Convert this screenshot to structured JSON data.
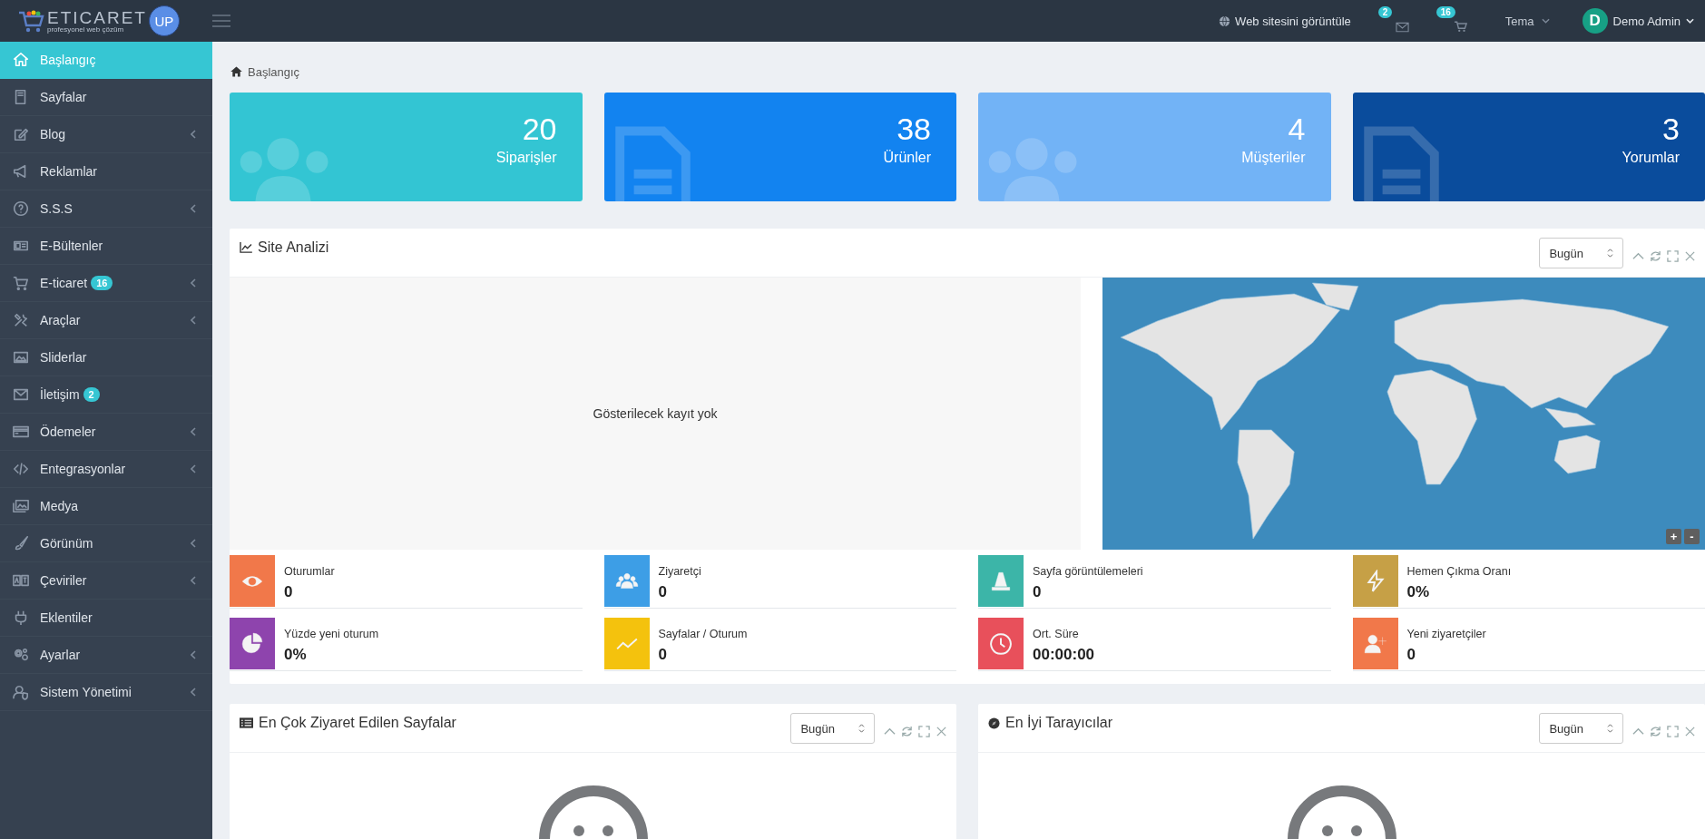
{
  "logo": {
    "name": "ETICARET",
    "badge": "UP",
    "tagline": "profesyonel web çözüm"
  },
  "topbar": {
    "site_link": "Web sitesini görüntüle",
    "messages_badge": "2",
    "orders_badge": "16",
    "theme": "Tema",
    "avatar_letter": "D",
    "user": "Demo Admin"
  },
  "sidebar": {
    "items": [
      {
        "label": "Başlangıç",
        "selected": true,
        "submenu": false
      },
      {
        "label": "Sayfalar",
        "selected": false,
        "submenu": false
      },
      {
        "label": "Blog",
        "selected": false,
        "submenu": true
      },
      {
        "label": "Reklamlar",
        "selected": false,
        "submenu": false
      },
      {
        "label": "S.S.S",
        "selected": false,
        "submenu": true
      },
      {
        "label": "E-Bültenler",
        "selected": false,
        "submenu": false
      },
      {
        "label": "E-ticaret",
        "selected": false,
        "submenu": true,
        "badge": "16"
      },
      {
        "label": "Araçlar",
        "selected": false,
        "submenu": true
      },
      {
        "label": "Sliderlar",
        "selected": false,
        "submenu": false
      },
      {
        "label": "İletişim",
        "selected": false,
        "submenu": false,
        "badge": "2"
      },
      {
        "label": "Ödemeler",
        "selected": false,
        "submenu": true
      },
      {
        "label": "Entegrasyonlar",
        "selected": false,
        "submenu": true
      },
      {
        "label": "Medya",
        "selected": false,
        "submenu": false
      },
      {
        "label": "Görünüm",
        "selected": false,
        "submenu": true
      },
      {
        "label": "Çeviriler",
        "selected": false,
        "submenu": true
      },
      {
        "label": "Eklentiler",
        "selected": false,
        "submenu": false
      },
      {
        "label": "Ayarlar",
        "selected": false,
        "submenu": true
      },
      {
        "label": "Sistem Yönetimi",
        "selected": false,
        "submenu": true
      }
    ]
  },
  "breadcrumb": "Başlangıç",
  "stats": [
    {
      "value": "20",
      "label": "Siparişler",
      "color": "#33c5d3",
      "kind": "people"
    },
    {
      "value": "38",
      "label": "Ürünler",
      "color": "#1283f0",
      "kind": "document"
    },
    {
      "value": "4",
      "label": "Müşteriler",
      "color": "#72b3f6",
      "kind": "people"
    },
    {
      "value": "3",
      "label": "Yorumlar",
      "color": "#0a4c9c",
      "kind": "document"
    }
  ],
  "site_analysis": {
    "title": "Site Analizi",
    "period": "Bugün",
    "empty_message": "Gösterilecek kayıt yok",
    "map_zoom_in": "+",
    "map_zoom_out": "-",
    "metrics": [
      {
        "label": "Oturumlar",
        "value": "0",
        "color": "#f1784a",
        "kind": "eye"
      },
      {
        "label": "Ziyaretçi",
        "value": "0",
        "color": "#3d9ee6",
        "kind": "users"
      },
      {
        "label": "Sayfa görüntülemeleri",
        "value": "0",
        "color": "#3cb5a8",
        "kind": "cone"
      },
      {
        "label": "Hemen Çıkma Oranı",
        "value": "0%",
        "color": "#c6a046",
        "kind": "bolt"
      },
      {
        "label": "Yüzde yeni oturum",
        "value": "0%",
        "color": "#8e44ad",
        "kind": "pie"
      },
      {
        "label": "Sayfalar / Oturum",
        "value": "0",
        "color": "#f4c20d",
        "kind": "line"
      },
      {
        "label": "Ort. Süre",
        "value": "00:00:00",
        "color": "#e8505b",
        "kind": "clock"
      },
      {
        "label": "Yeni ziyaretçiler",
        "value": "0",
        "color": "#f1784a",
        "kind": "adduser"
      }
    ]
  },
  "bottom_panels": [
    {
      "title": "En Çok Ziyaret Edilen Sayfalar",
      "period": "Bugün",
      "kind": "list"
    },
    {
      "title": "En İyi Tarayıcılar",
      "period": "Bugün",
      "kind": "browser"
    }
  ]
}
